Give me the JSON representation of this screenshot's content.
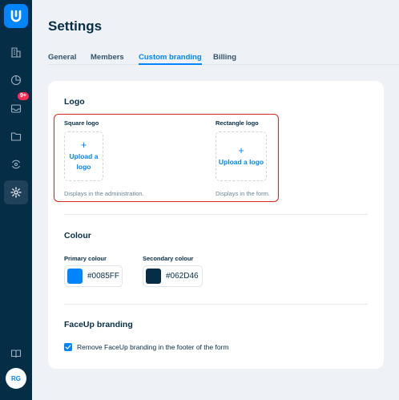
{
  "sidebar": {
    "badge": "9+",
    "avatar": "RG",
    "icons": [
      "building-icon",
      "chart-icon",
      "inbox-icon",
      "folder-icon",
      "sync-icon",
      "gear-icon",
      "book-icon"
    ]
  },
  "header": {
    "title": "Settings"
  },
  "tabs": [
    {
      "label": "General"
    },
    {
      "label": "Members"
    },
    {
      "label": "Custom branding",
      "active": true
    },
    {
      "label": "Billing"
    }
  ],
  "logo_section": {
    "title": "Logo",
    "square": {
      "label": "Square logo",
      "upload": "Upload a logo",
      "hint": "Displays in the administration."
    },
    "rectangle": {
      "label": "Rectangle logo",
      "upload": "Upload a logo",
      "hint": "Displays in the form."
    }
  },
  "colour_section": {
    "title": "Colour",
    "primary": {
      "label": "Primary colour",
      "value": "#0085FF"
    },
    "secondary": {
      "label": "Secondary colour",
      "value": "#062D46"
    }
  },
  "branding_section": {
    "title": "FaceUp branding",
    "checkbox_label": "Remove FaceUp branding in the footer of the form",
    "checked": true
  },
  "colors": {
    "accent": "#0085ff",
    "sidebar": "#062d46",
    "highlight": "#e0261b"
  }
}
